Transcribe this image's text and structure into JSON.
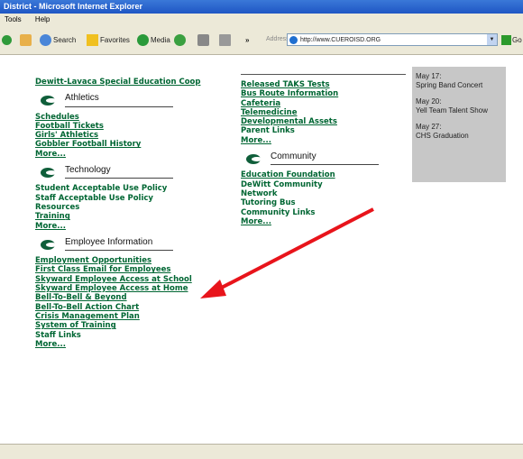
{
  "window": {
    "title": "District - Microsoft Internet Explorer"
  },
  "menu": [
    "Tools",
    "Help"
  ],
  "toolbar": {
    "search": "Search",
    "favorites": "Favorites",
    "media": "Media",
    "address_label": "Address",
    "url": "http://www.CUEROISD.ORG",
    "go": "Go"
  },
  "left": {
    "top_link": "Dewitt-Lavaca Special Education Coop",
    "athletics": {
      "title": "Athletics",
      "links": [
        "Schedules",
        "Football Tickets",
        "Girls' Athletics",
        "Gobbler Football History",
        "More..."
      ]
    },
    "technology": {
      "title": "Technology",
      "links": [
        "Student Acceptable Use Policy",
        "Staff Acceptable Use Policy",
        "Resources",
        "Training",
        "More..."
      ]
    },
    "employee": {
      "title": "Employee Information",
      "links": [
        "Employment Opportunities",
        "First Class Email for Employees",
        "Skyward Employee Access at School",
        "Skyward Employee Access at Home",
        "Bell-To-Bell & Beyond",
        "Bell-To-Bell Action Chart",
        "Crisis Management Plan",
        "System of Training",
        "Staff Links",
        "More..."
      ]
    }
  },
  "middle": {
    "links": [
      "Released TAKS Tests",
      "Bus Route Information",
      "Cafeteria",
      "Telemedicine",
      "Developmental Assets",
      "Parent Links",
      "More..."
    ],
    "community": {
      "title": "Community",
      "links": [
        "Education Foundation",
        "DeWitt Community",
        "Network",
        "Tutoring Bus",
        "Community Links",
        "More..."
      ]
    }
  },
  "events": [
    {
      "date": "May 17:",
      "text": "Spring Band Concert"
    },
    {
      "date": "May 20:",
      "text": "Yell Team Talent Show"
    },
    {
      "date": "May 27:",
      "text": "CHS Graduation"
    }
  ],
  "colors": {
    "link": "#006633",
    "arrow": "#e8141b",
    "sidebar": "#c7c7c7"
  }
}
